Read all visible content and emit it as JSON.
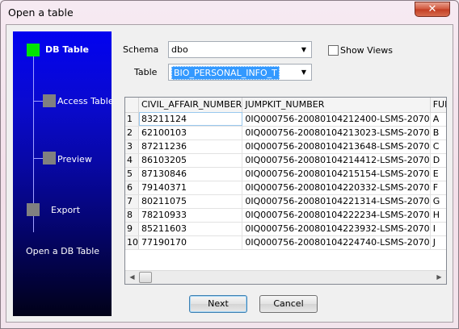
{
  "window": {
    "title": "Open a table",
    "close_glyph": "✕"
  },
  "wizard": {
    "current_step": "DB Table",
    "steps": [
      "Access Table",
      "Preview",
      "Export"
    ],
    "description": "Open a DB Table"
  },
  "form": {
    "schema_label": "Schema",
    "schema_value": "dbo",
    "table_label": "Table",
    "table_value": "BIO_PERSONAL_INFO_T",
    "show_views_label": "Show Views",
    "show_views_checked": false
  },
  "grid": {
    "columns": [
      "CIVIL_AFFAIR_NUMBER",
      "JUMPKIT_NUMBER",
      "FUL"
    ],
    "rows": [
      [
        "1",
        "83211124",
        "0IQ000756-20080104212400-LSMS-2070",
        "A"
      ],
      [
        "2",
        "62100103",
        "0IQ000756-20080104213023-LSMS-2070",
        "B"
      ],
      [
        "3",
        "87211236",
        "0IQ000756-20080104213648-LSMS-2070",
        "C"
      ],
      [
        "4",
        "86103205",
        "0IQ000756-20080104214412-LSMS-2070",
        "D"
      ],
      [
        "5",
        "87130846",
        "0IQ000756-20080104215154-LSMS-2070",
        "E"
      ],
      [
        "6",
        "79140371",
        "0IQ000756-20080104220332-LSMS-2070",
        "F"
      ],
      [
        "7",
        "80211075",
        "0IQ000756-20080104221314-LSMS-2070",
        "G"
      ],
      [
        "8",
        "78210933",
        "0IQ000756-20080104222234-LSMS-2070",
        "H"
      ],
      [
        "9",
        "85211603",
        "0IQ000756-20080104223932-LSMS-2070",
        "I"
      ],
      [
        "10",
        "77190170",
        "0IQ000756-20080104224740-LSMS-2070",
        "J"
      ]
    ]
  },
  "buttons": {
    "next": "Next",
    "cancel": "Cancel"
  },
  "icons": {
    "dropdown": "dropdown-arrow-icon",
    "scroll_left": "scroll-left-icon",
    "scroll_right": "scroll-right-icon"
  },
  "colors": {
    "accent_green": "#00e400",
    "selection_blue": "#3399ff",
    "panel_top": "#0202f0",
    "panel_bottom": "#010118"
  }
}
